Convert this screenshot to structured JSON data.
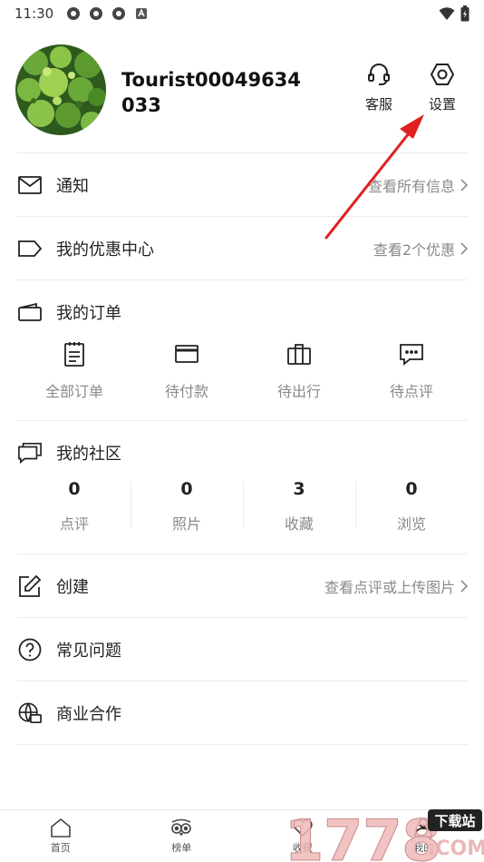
{
  "status_bar": {
    "time": "11:30"
  },
  "profile": {
    "username": "Tourist00049634033",
    "customer_service_label": "客服",
    "settings_label": "设置"
  },
  "notifications": {
    "label": "通知",
    "link": "查看所有信息"
  },
  "coupons": {
    "label": "我的优惠中心",
    "link": "查看2个优惠"
  },
  "orders": {
    "label": "我的订单",
    "items": [
      {
        "label": "全部订单",
        "icon": "clipboard-icon"
      },
      {
        "label": "待付款",
        "icon": "card-icon"
      },
      {
        "label": "待出行",
        "icon": "suitcase-icon"
      },
      {
        "label": "待点评",
        "icon": "comment-icon"
      }
    ]
  },
  "community": {
    "label": "我的社区",
    "stats": [
      {
        "value": "0",
        "label": "点评"
      },
      {
        "value": "0",
        "label": "照片"
      },
      {
        "value": "3",
        "label": "收藏"
      },
      {
        "value": "0",
        "label": "浏览"
      }
    ]
  },
  "create": {
    "label": "创建",
    "link": "查看点评或上传图片"
  },
  "faq": {
    "label": "常见问题"
  },
  "business": {
    "label": "商业合作"
  },
  "tabs": [
    {
      "label": "首页",
      "icon": "home-icon"
    },
    {
      "label": "榜单",
      "icon": "owl-icon"
    },
    {
      "label": "收藏",
      "icon": "heart-icon"
    },
    {
      "label": "我的",
      "icon": "user-icon"
    }
  ],
  "watermark": {
    "text": "1778",
    "badge": "下载站",
    "suffix": ".COM"
  },
  "colors": {
    "accent_arrow": "#e02020",
    "muted_text": "#8a8a8a"
  }
}
